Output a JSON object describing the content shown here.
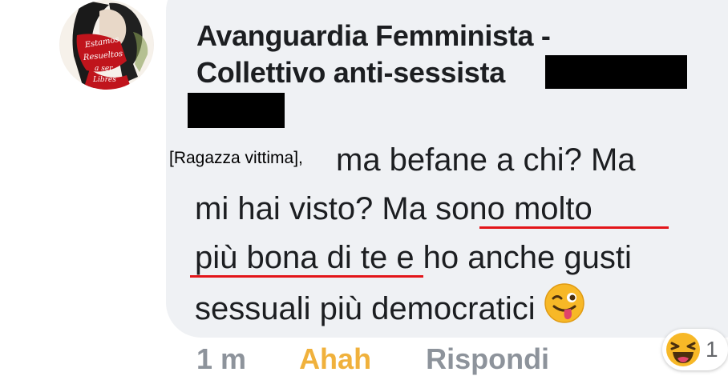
{
  "comment": {
    "author": {
      "line1": "Avanguardia Femminista -",
      "line2": "Collettivo anti-sessista"
    },
    "avatar_text": [
      "Estamos",
      "Resueltos",
      "a ser",
      "Libres"
    ],
    "victim_tag": "[Ragazza vittima],",
    "text_lines": [
      "ma befane a chi? Ma",
      "mi hai visto? Ma sono molto",
      "più bona di te e ho anche gusti",
      "sessuali più democratici"
    ],
    "text_parts": {
      "line2_a": "mi hai visto? Ma ",
      "line2_b": "sono molto",
      "line3_a": "più bona di te",
      "line3_b": " e ho anche gusti"
    }
  },
  "actions": {
    "time": "1 m",
    "reaction_label": "Ahah",
    "reply_label": "Rispondi"
  },
  "reactions": {
    "icon": "laughing-face-icon",
    "count": "1"
  },
  "colors": {
    "bubble_bg": "#eff1f4",
    "underline": "#e3151a",
    "reaction_active": "#f0b13c",
    "muted": "#8d939b"
  }
}
